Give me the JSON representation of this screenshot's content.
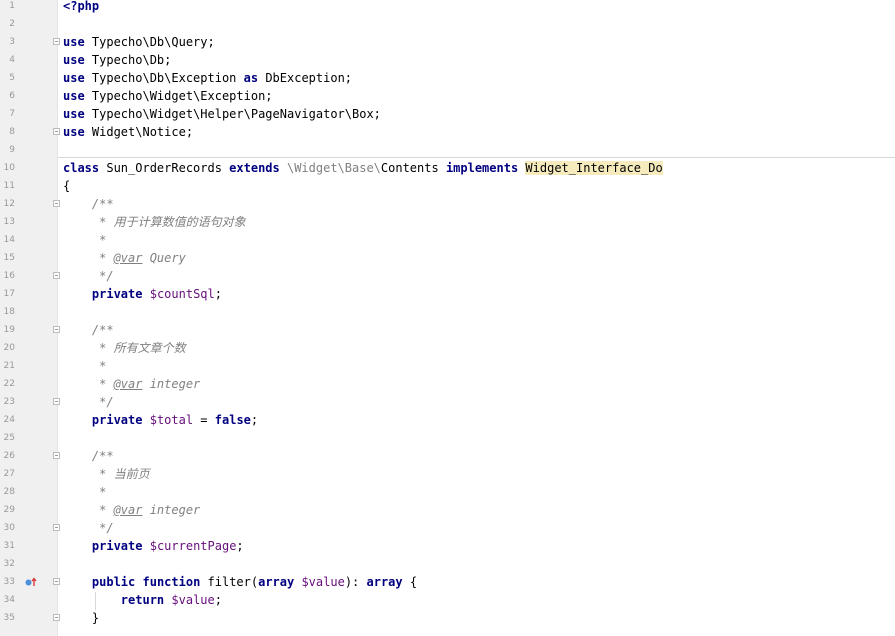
{
  "editor": {
    "lines": [
      {
        "n": "1",
        "fold": false,
        "segs": [
          {
            "t": "<?php",
            "c": "kw"
          }
        ]
      },
      {
        "n": "2",
        "fold": false,
        "segs": []
      },
      {
        "n": "3",
        "fold": true,
        "segs": [
          {
            "t": "use",
            "c": "kw"
          },
          {
            "t": " Typecho\\Db\\Query;",
            "c": ""
          }
        ]
      },
      {
        "n": "4",
        "fold": false,
        "segs": [
          {
            "t": "use",
            "c": "kw"
          },
          {
            "t": " Typecho\\Db;",
            "c": ""
          }
        ]
      },
      {
        "n": "5",
        "fold": false,
        "segs": [
          {
            "t": "use",
            "c": "kw"
          },
          {
            "t": " Typecho\\Db\\Exception ",
            "c": ""
          },
          {
            "t": "as",
            "c": "kw"
          },
          {
            "t": " DbException;",
            "c": ""
          }
        ]
      },
      {
        "n": "6",
        "fold": false,
        "segs": [
          {
            "t": "use",
            "c": "kw"
          },
          {
            "t": " Typecho\\Widget\\Exception;",
            "c": ""
          }
        ]
      },
      {
        "n": "7",
        "fold": false,
        "segs": [
          {
            "t": "use",
            "c": "kw"
          },
          {
            "t": " Typecho\\Widget\\Helper\\PageNavigator\\Box;",
            "c": ""
          }
        ]
      },
      {
        "n": "8",
        "fold": true,
        "segs": [
          {
            "t": "use",
            "c": "kw"
          },
          {
            "t": " Widget\\Notice;",
            "c": ""
          }
        ]
      },
      {
        "n": "9",
        "fold": false,
        "segs": []
      },
      {
        "n": "10",
        "fold": false,
        "segs": [
          {
            "t": "class",
            "c": "kw"
          },
          {
            "t": " Sun_OrderRecords ",
            "c": ""
          },
          {
            "t": "extends",
            "c": "kw"
          },
          {
            "t": " ",
            "c": ""
          },
          {
            "t": "\\Widget\\Base\\",
            "c": "ns"
          },
          {
            "t": "Contents ",
            "c": ""
          },
          {
            "t": "implements",
            "c": "kw"
          },
          {
            "t": " ",
            "c": ""
          },
          {
            "t": "Widget_Interface_Do",
            "c": "hl"
          }
        ]
      },
      {
        "n": "11",
        "fold": false,
        "segs": [
          {
            "t": "{",
            "c": ""
          }
        ]
      },
      {
        "n": "12",
        "fold": true,
        "segs": [
          {
            "t": "    /**",
            "c": "cmt"
          }
        ]
      },
      {
        "n": "13",
        "fold": false,
        "segs": [
          {
            "t": "     * 用于计算数值的语句对象",
            "c": "cmt"
          }
        ]
      },
      {
        "n": "14",
        "fold": false,
        "segs": [
          {
            "t": "     *",
            "c": "cmt"
          }
        ]
      },
      {
        "n": "15",
        "fold": false,
        "segs": [
          {
            "t": "     * ",
            "c": "cmt"
          },
          {
            "t": "@var",
            "c": "cmt tag"
          },
          {
            "t": " Query",
            "c": "cmt"
          }
        ]
      },
      {
        "n": "16",
        "fold": true,
        "segs": [
          {
            "t": "     */",
            "c": "cmt"
          }
        ]
      },
      {
        "n": "17",
        "fold": false,
        "segs": [
          {
            "t": "    ",
            "c": ""
          },
          {
            "t": "private",
            "c": "kw"
          },
          {
            "t": " ",
            "c": ""
          },
          {
            "t": "$countSql",
            "c": "var"
          },
          {
            "t": ";",
            "c": ""
          }
        ]
      },
      {
        "n": "18",
        "fold": false,
        "segs": []
      },
      {
        "n": "19",
        "fold": true,
        "segs": [
          {
            "t": "    /**",
            "c": "cmt"
          }
        ]
      },
      {
        "n": "20",
        "fold": false,
        "segs": [
          {
            "t": "     * 所有文章个数",
            "c": "cmt"
          }
        ]
      },
      {
        "n": "21",
        "fold": false,
        "segs": [
          {
            "t": "     *",
            "c": "cmt"
          }
        ]
      },
      {
        "n": "22",
        "fold": false,
        "segs": [
          {
            "t": "     * ",
            "c": "cmt"
          },
          {
            "t": "@var",
            "c": "cmt tag"
          },
          {
            "t": " integer",
            "c": "cmt"
          }
        ]
      },
      {
        "n": "23",
        "fold": true,
        "segs": [
          {
            "t": "     */",
            "c": "cmt"
          }
        ]
      },
      {
        "n": "24",
        "fold": false,
        "segs": [
          {
            "t": "    ",
            "c": ""
          },
          {
            "t": "private",
            "c": "kw"
          },
          {
            "t": " ",
            "c": ""
          },
          {
            "t": "$total",
            "c": "var"
          },
          {
            "t": " = ",
            "c": ""
          },
          {
            "t": "false",
            "c": "kw"
          },
          {
            "t": ";",
            "c": ""
          }
        ]
      },
      {
        "n": "25",
        "fold": false,
        "segs": []
      },
      {
        "n": "26",
        "fold": true,
        "segs": [
          {
            "t": "    /**",
            "c": "cmt"
          }
        ]
      },
      {
        "n": "27",
        "fold": false,
        "segs": [
          {
            "t": "     * 当前页",
            "c": "cmt"
          }
        ]
      },
      {
        "n": "28",
        "fold": false,
        "segs": [
          {
            "t": "     *",
            "c": "cmt"
          }
        ]
      },
      {
        "n": "29",
        "fold": false,
        "segs": [
          {
            "t": "     * ",
            "c": "cmt"
          },
          {
            "t": "@var",
            "c": "cmt tag"
          },
          {
            "t": " integer",
            "c": "cmt"
          }
        ]
      },
      {
        "n": "30",
        "fold": true,
        "segs": [
          {
            "t": "     */",
            "c": "cmt"
          }
        ]
      },
      {
        "n": "31",
        "fold": false,
        "segs": [
          {
            "t": "    ",
            "c": ""
          },
          {
            "t": "private",
            "c": "kw"
          },
          {
            "t": " ",
            "c": ""
          },
          {
            "t": "$currentPage",
            "c": "var"
          },
          {
            "t": ";",
            "c": ""
          }
        ]
      },
      {
        "n": "32",
        "fold": false,
        "segs": []
      },
      {
        "n": "33",
        "fold": true,
        "marker": true,
        "segs": [
          {
            "t": "    ",
            "c": ""
          },
          {
            "t": "public",
            "c": "kw"
          },
          {
            "t": " ",
            "c": ""
          },
          {
            "t": "function",
            "c": "kw"
          },
          {
            "t": " filter(",
            "c": ""
          },
          {
            "t": "array",
            "c": "kw"
          },
          {
            "t": " ",
            "c": ""
          },
          {
            "t": "$value",
            "c": "var"
          },
          {
            "t": "): ",
            "c": ""
          },
          {
            "t": "array",
            "c": "kw"
          },
          {
            "t": " {",
            "c": ""
          }
        ]
      },
      {
        "n": "34",
        "fold": false,
        "segs": [
          {
            "t": "        ",
            "c": ""
          },
          {
            "t": "return",
            "c": "kw"
          },
          {
            "t": " ",
            "c": ""
          },
          {
            "t": "$value",
            "c": "var"
          },
          {
            "t": ";",
            "c": ""
          }
        ]
      },
      {
        "n": "35",
        "fold": true,
        "segs": [
          {
            "t": "    }",
            "c": ""
          }
        ]
      }
    ]
  }
}
